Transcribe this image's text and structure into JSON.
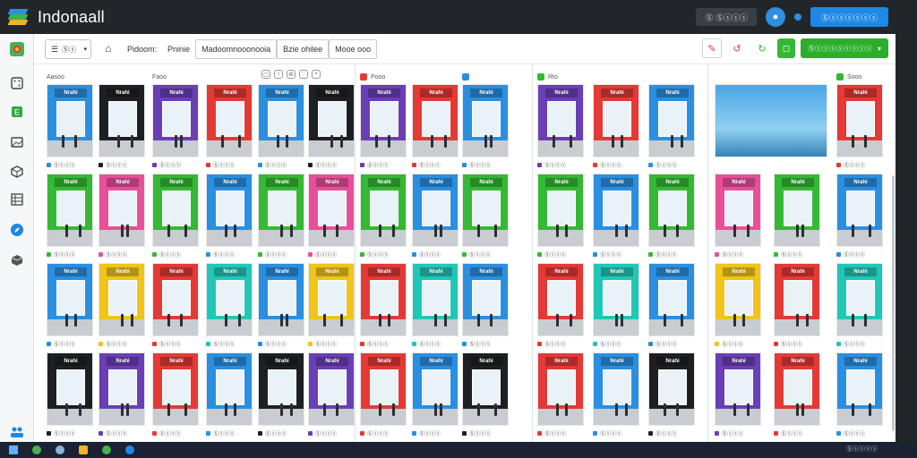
{
  "app": {
    "title": "Indonaall"
  },
  "topbar": {
    "search_label": "Ⓢ Ⓢⓢⓢⓢ",
    "account_button": "Ⓢⓢⓢⓢⓢⓢⓢ",
    "accent": "#1e88e5"
  },
  "toolbar": {
    "view_select": "Ⓢⓢ",
    "breadcrumb": [
      "Pidoom:",
      "Pninie",
      "Madoomnooonooia",
      "Bzie ohilee",
      "Mooe ooo"
    ],
    "action_button": "Ⓢⓢⓢⓢⓢⓢⓢⓢⓢ"
  },
  "columns": [
    {
      "header": "Aasoo",
      "header2": "Faoo",
      "color": "#2a8fe0"
    },
    {
      "header": "Pooo",
      "color": "#e53935"
    },
    {
      "header": "Rto",
      "color": "#35b835"
    },
    {
      "header": "Sooo",
      "color": "#35b835"
    }
  ],
  "tile_caption": "Ⓢⓢⓢⓢ",
  "store_sign": "Nrahi",
  "brand_colors": {
    "blue": "#2a8fe0",
    "red": "#e53935",
    "green": "#35b835",
    "yellow": "#f0c419",
    "purple": "#6a3fb5",
    "teal": "#21c7b6",
    "pink": "#e84f9a",
    "black": "#1e1f23"
  },
  "taskbar": {
    "clock": "Ⓢⓢⓢⓢⓢ"
  }
}
